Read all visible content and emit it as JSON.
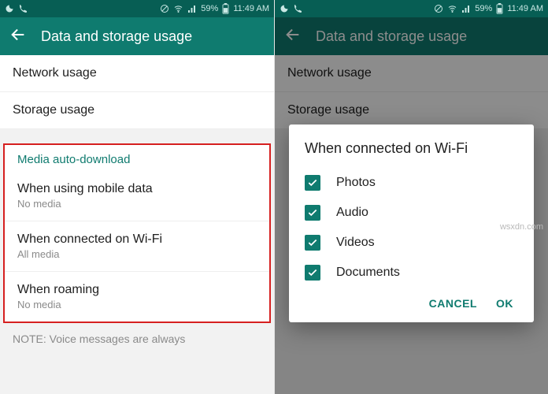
{
  "statusbar": {
    "battery": "59%",
    "time": "11:49 AM"
  },
  "toolbar": {
    "title": "Data and storage usage"
  },
  "settings": {
    "network_usage": "Network usage",
    "storage_usage": "Storage usage",
    "section_media": "Media auto-download",
    "mobile_data": {
      "title": "When using mobile data",
      "sub": "No media"
    },
    "wifi": {
      "title": "When connected on Wi-Fi",
      "sub": "All media"
    },
    "roaming": {
      "title": "When roaming",
      "sub": "No media"
    },
    "note": "NOTE: Voice messages are always"
  },
  "dialog": {
    "title": "When connected on Wi-Fi",
    "options": {
      "photos": "Photos",
      "audio": "Audio",
      "videos": "Videos",
      "documents": "Documents"
    },
    "cancel": "CANCEL",
    "ok": "OK"
  },
  "watermark": "wsxdn.com"
}
